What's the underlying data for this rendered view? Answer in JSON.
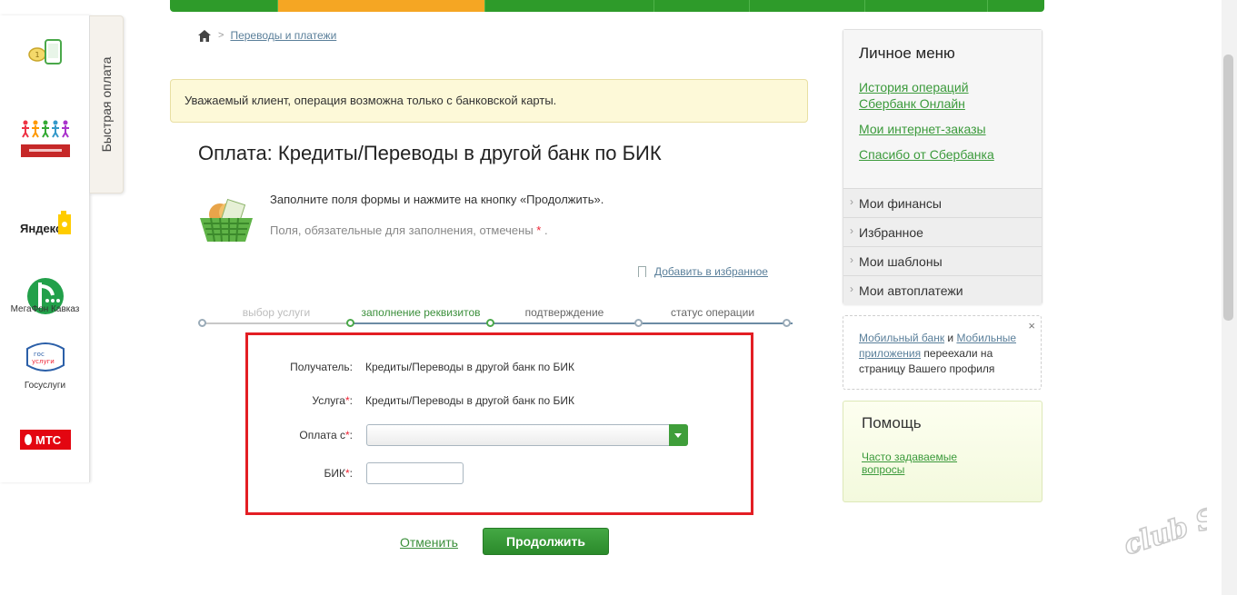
{
  "quick_pay": {
    "tab_label": "Быстрая оплата",
    "items": [
      {
        "name": "phone-payment",
        "label": ""
      },
      {
        "name": "podari-zhizn",
        "label": ""
      },
      {
        "name": "yandex",
        "label": ""
      },
      {
        "name": "megafon-kavkaz",
        "label": "МегаФон Кавказ"
      },
      {
        "name": "gosuslugi",
        "label": "Госуслуги"
      },
      {
        "name": "mts",
        "label": ""
      }
    ],
    "logo_text": {
      "yandex": "Яндекс",
      "gosuslugi_top": "гос",
      "gosuslugi_bottom": "услуги",
      "mts": "МТС"
    }
  },
  "breadcrumb": {
    "item": "Переводы и платежи"
  },
  "notice": "Уважаемый клиент, операция возможна только с банковской карты.",
  "page_title": "Оплата: Кредиты/Переводы в другой банк по БИК",
  "hints": {
    "line1": "Заполните поля формы и нажмите на кнопку «Продолжить».",
    "line2": "Поля, обязательные для заполнения, отмечены",
    "required_mark": "*",
    "line2_end": "."
  },
  "favorite_link": "Добавить в избранное",
  "steps": [
    {
      "label": "выбор услуги",
      "state": "past"
    },
    {
      "label": "заполнение реквизитов",
      "state": "active"
    },
    {
      "label": "подтверждение",
      "state": "next"
    },
    {
      "label": "статус операции",
      "state": "next"
    }
  ],
  "form": {
    "recipient_label": "Получатель:",
    "recipient_value": "Кредиты/Переводы в другой банк по БИК",
    "service_label": "Услуга",
    "service_value": "Кредиты/Переводы в другой банк по БИК",
    "pay_from_label": "Оплата с",
    "bik_label": "БИК",
    "required_mark": "*",
    "colon": ":"
  },
  "actions": {
    "cancel": "Отменить",
    "continue": "Продолжить"
  },
  "personal_menu": {
    "title": "Личное меню",
    "links": [
      "История операций Сбербанк Онлайн",
      "Мои интернет-заказы",
      "Спасибо от Сбербанка"
    ],
    "sections": [
      "Мои финансы",
      "Избранное",
      "Мои шаблоны",
      "Мои автоплатежи"
    ]
  },
  "mobile_note": {
    "link1": "Мобильный банк",
    "and": " и ",
    "link2": "Мобильные приложения",
    "text": " переехали на страницу Вашего профиля",
    "close": "×"
  },
  "help": {
    "title": "Помощь",
    "faq": "Часто задаваемые вопросы"
  },
  "watermark": "club Sovet",
  "colors": {
    "brand_green": "#2e9b2a",
    "active_orange": "#f5a623",
    "highlight_red": "#e31e24"
  }
}
